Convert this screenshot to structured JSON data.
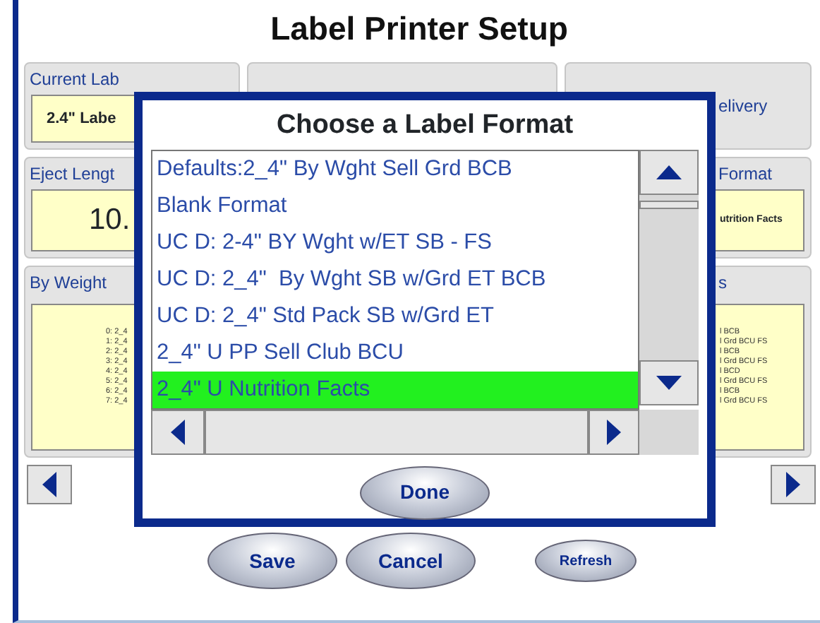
{
  "title": "Label Printer Setup",
  "current_label_stock": {
    "label": "Current Lab",
    "value": "2.4\" Labe"
  },
  "delivery": {
    "text": "elivery"
  },
  "eject_length": {
    "label": "Eject Lengt",
    "value": "10."
  },
  "format": {
    "label": "Format",
    "value": "utrition Facts"
  },
  "by_weight": {
    "label": "By Weight",
    "items": [
      "0: 2_4",
      "1: 2_4",
      "2: 2_4",
      "3: 2_4",
      "4: 2_4",
      "5: 2_4",
      "6: 2_4",
      "7: 2_4"
    ]
  },
  "format_list": {
    "label": "s",
    "items": [
      "l BCB",
      "l Grd BCU FS",
      "l BCB",
      "l Grd BCU FS",
      "l BCD",
      "l Grd BCU FS",
      "l BCB",
      "l Grd BCU FS"
    ]
  },
  "dialog": {
    "title": "Choose a Label Format",
    "items": [
      {
        "label": "Defaults:2_4\" By Wght Sell Grd BCB",
        "selected": false
      },
      {
        "label": "Blank Format",
        "selected": false
      },
      {
        "label": "UC D: 2-4\" BY Wght w/ET SB - FS",
        "selected": false
      },
      {
        "label": "UC D: 2_4\"  By Wght SB w/Grd ET BCB",
        "selected": false
      },
      {
        "label": "UC D: 2_4\" Std Pack SB w/Grd ET",
        "selected": false
      },
      {
        "label": "2_4\" U PP Sell Club BCU",
        "selected": false
      },
      {
        "label": "2_4\" U Nutrition Facts",
        "selected": true
      }
    ],
    "done": "Done"
  },
  "buttons": [
    {
      "label": "Save",
      "kind": "large"
    },
    {
      "label": "Cancel",
      "kind": "large"
    },
    {
      "label": "Refresh",
      "kind": "small"
    }
  ]
}
